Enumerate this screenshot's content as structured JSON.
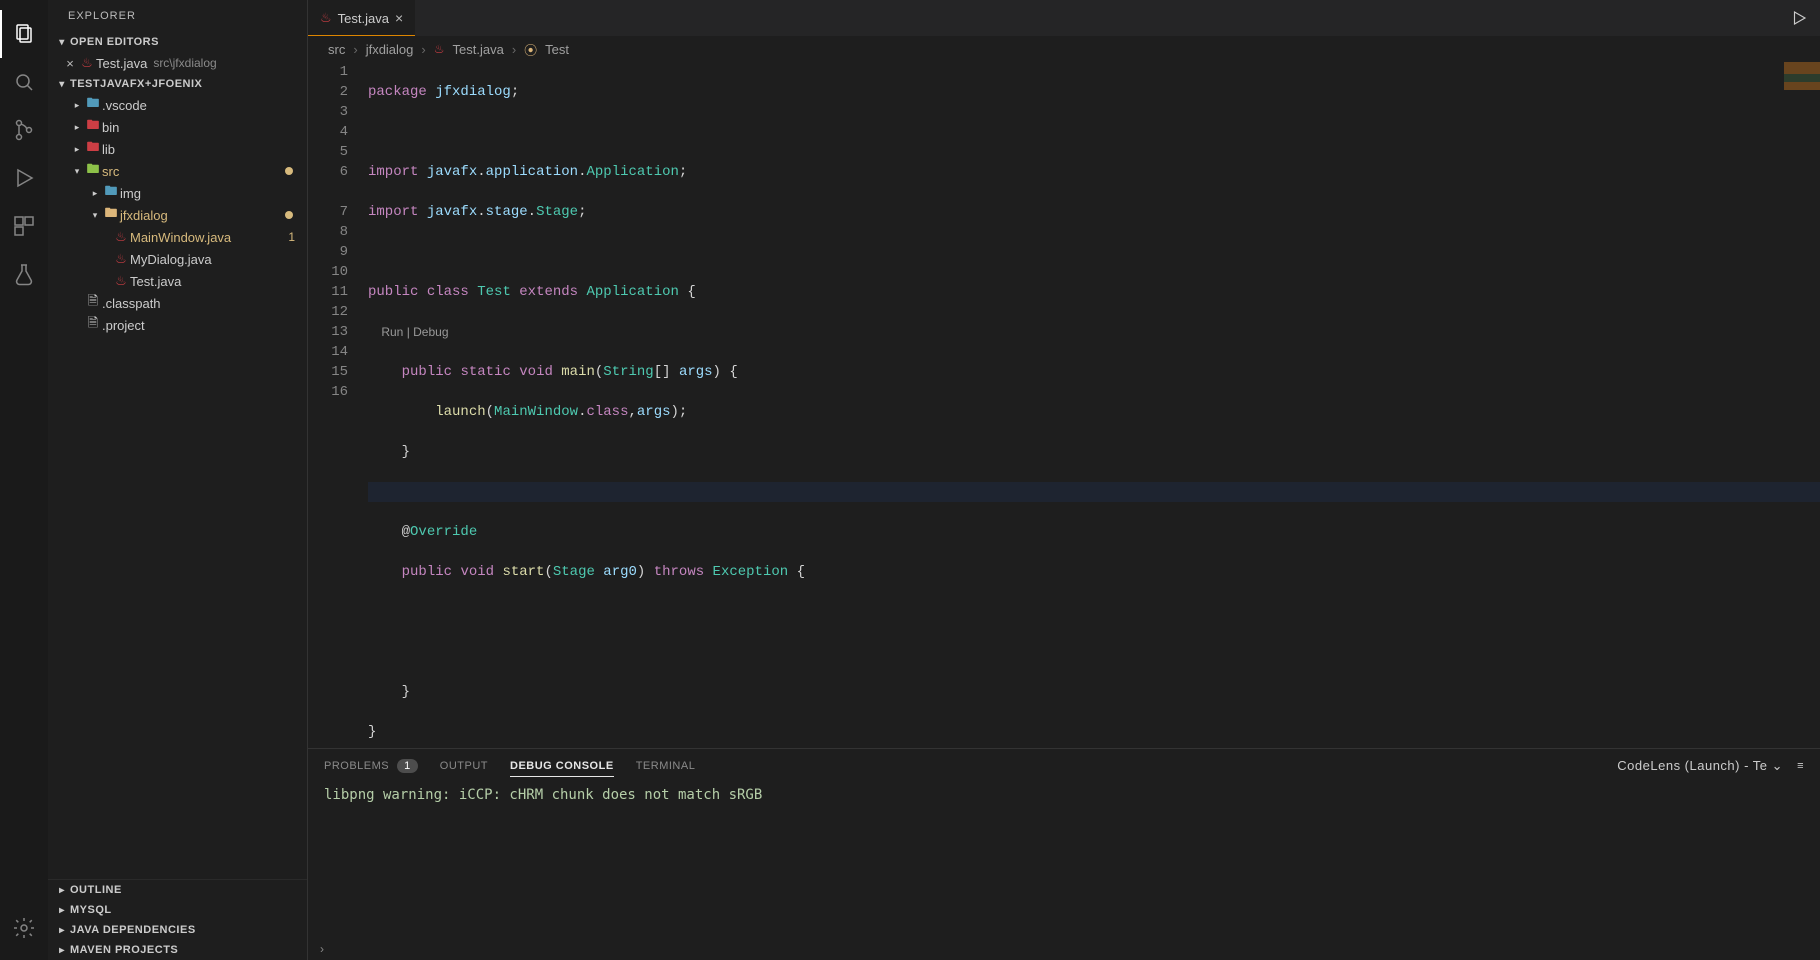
{
  "sidebar": {
    "title": "EXPLORER",
    "sections": {
      "openEditors": "OPEN EDITORS",
      "project": "TESTJAVAFX+JFOENIX",
      "outline": "OUTLINE",
      "mysql": "MYSQL",
      "javaDeps": "JAVA DEPENDENCIES",
      "maven": "MAVEN PROJECTS"
    },
    "openEditor": {
      "name": "Test.java",
      "path": "src\\jfxdialog"
    },
    "tree": {
      "vscode": ".vscode",
      "bin": "bin",
      "lib": "lib",
      "src": "src",
      "img": "img",
      "jfxdialog": "jfxdialog",
      "mainwindow": "MainWindow.java",
      "mainwindow_badge": "1",
      "mydialog": "MyDialog.java",
      "testjava": "Test.java",
      "classpath": ".classpath",
      "project": ".project"
    }
  },
  "tab": {
    "label": "Test.java"
  },
  "breadcrumbs": {
    "p1": "src",
    "p2": "jfxdialog",
    "p3": "Test.java",
    "p4": "Test"
  },
  "code": {
    "codelens": "Run | Debug",
    "l1": "package jfxdialog;",
    "l2": "",
    "l3": "import javafx.application.Application;",
    "l4": "import javafx.stage.Stage;",
    "l5": "",
    "l6": "public class Test extends Application {",
    "l7": "    public static void main(String[] args) {",
    "l8": "        launch(MainWindow.class,args);",
    "l9": "    }",
    "l10": "",
    "l11": "    @Override",
    "l12": "    public void start(Stage arg0) throws Exception {",
    "l13": "",
    "l14": "",
    "l15": "    }",
    "l16": "}"
  },
  "panel": {
    "tabs": {
      "problems": "PROBLEMS",
      "problems_count": "1",
      "output": "OUTPUT",
      "debug": "DEBUG CONSOLE",
      "terminal": "TERMINAL"
    },
    "launch": "CodeLens (Launch) - Te",
    "message": "libpng warning: iCCP: cHRM chunk does not match sRGB"
  },
  "gutter": [
    "1",
    "2",
    "3",
    "4",
    "5",
    "6",
    "",
    "7",
    "8",
    "9",
    "10",
    "11",
    "12",
    "13",
    "14",
    "15",
    "16"
  ]
}
